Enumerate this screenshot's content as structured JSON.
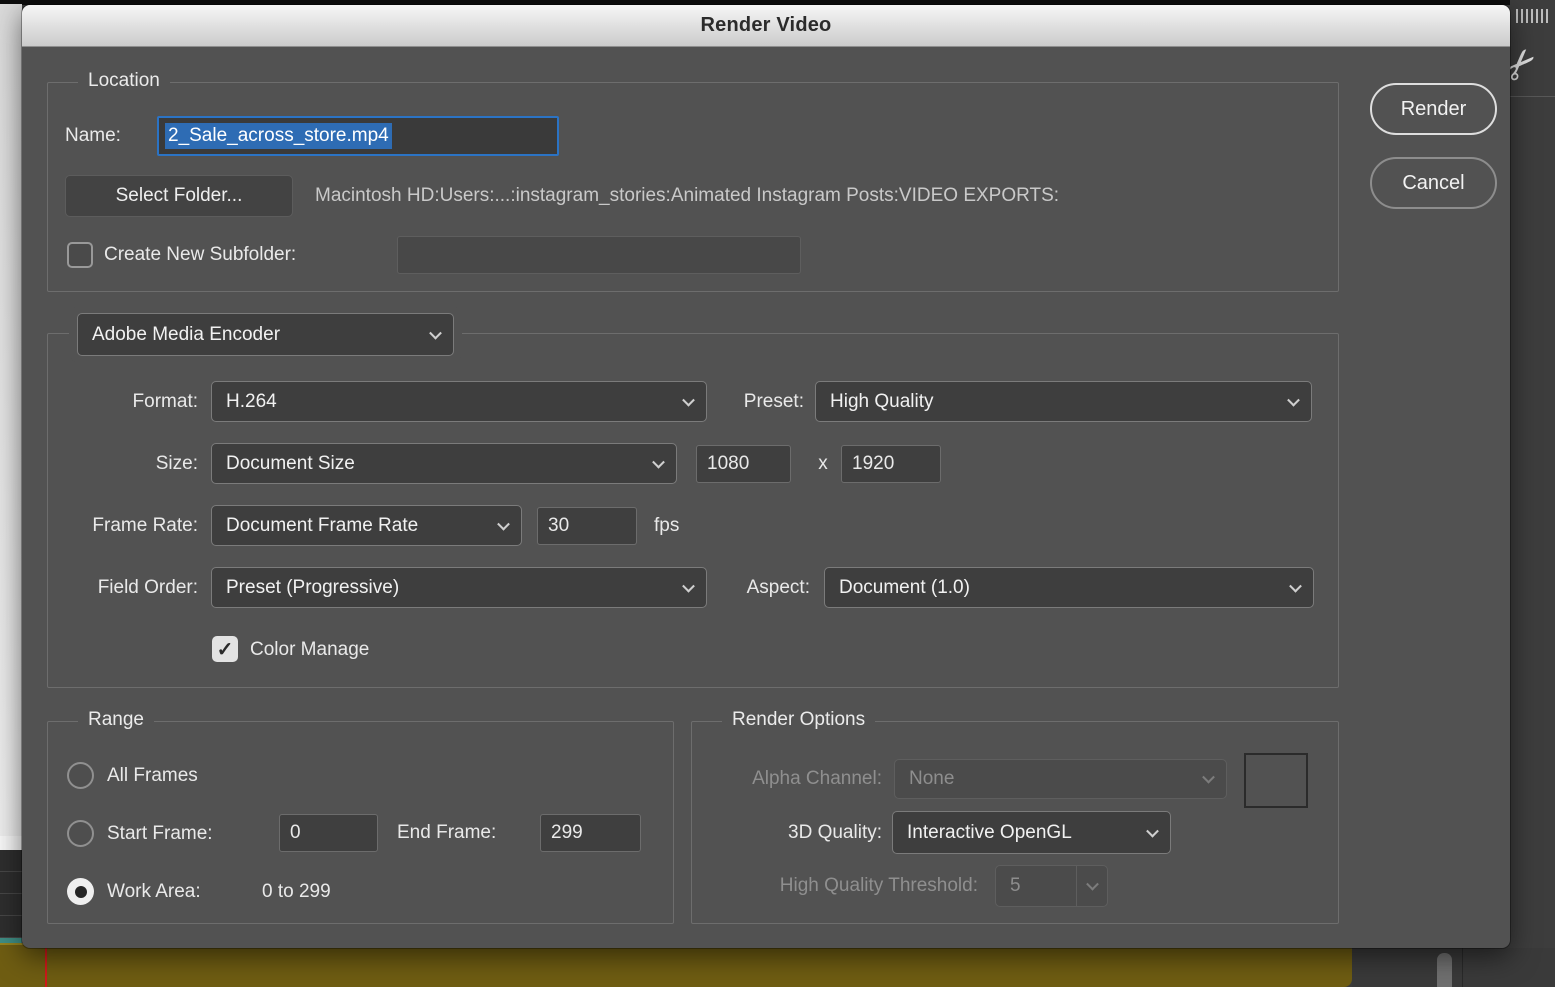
{
  "window": {
    "title": "Render Video"
  },
  "actions": {
    "render": "Render",
    "cancel": "Cancel"
  },
  "icons": {
    "check": "✓",
    "scissors": "✂"
  },
  "location": {
    "legend": "Location",
    "name_label": "Name:",
    "name_value": "2_Sale_across_store.mp4",
    "select_folder": "Select Folder...",
    "path": "Macintosh HD:Users:...:instagram_stories:Animated Instagram Posts:VIDEO EXPORTS:",
    "create_subfolder": "Create New Subfolder:",
    "subfolder_value": "",
    "subfolder_checked": false
  },
  "encoder": {
    "engine": "Adobe Media Encoder",
    "format_label": "Format:",
    "format": "H.264",
    "preset_label": "Preset:",
    "preset": "High Quality",
    "size_label": "Size:",
    "size": "Document Size",
    "width": "1080",
    "times": "x",
    "height": "1920",
    "frame_rate_label": "Frame Rate:",
    "frame_rate": "Document Frame Rate",
    "fps_value": "30",
    "fps_unit": "fps",
    "field_order_label": "Field Order:",
    "field_order": "Preset (Progressive)",
    "aspect_label": "Aspect:",
    "aspect": "Document (1.0)",
    "color_manage": "Color Manage",
    "color_manage_checked": true
  },
  "range": {
    "legend": "Range",
    "all_frames": "All Frames",
    "start_frame_label": "Start Frame:",
    "start_frame": "0",
    "end_frame_label": "End Frame:",
    "end_frame": "299",
    "work_area_label": "Work Area:",
    "work_area_range": "0 to 299",
    "selected": "work_area"
  },
  "render_options": {
    "legend": "Render Options",
    "alpha_label": "Alpha Channel:",
    "alpha": "None",
    "alpha_enabled": false,
    "quality_label": "3D Quality:",
    "quality": "Interactive OpenGL",
    "threshold_label": "High Quality Threshold:",
    "threshold": "5",
    "threshold_enabled": false
  },
  "colors": {
    "selection_blue": "#2e6cb4",
    "focus_blue": "#2b73c4",
    "dialog_gray": "#525252",
    "timeline_yellow": "#6f5d12",
    "playhead_red": "#d11a1a"
  }
}
